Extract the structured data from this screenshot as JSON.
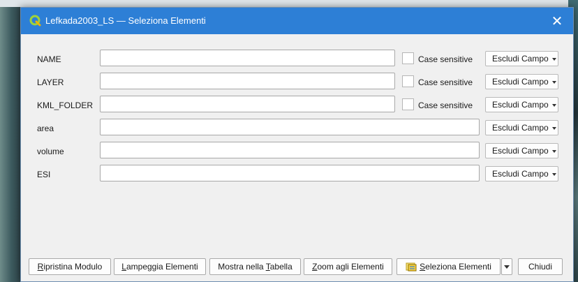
{
  "window": {
    "title": "Lefkada2003_LS — Seleziona Elementi",
    "close_glyph": "✕",
    "app_icon": "qgis-icon",
    "titlebar_color": "#2d7fd6"
  },
  "fields": [
    {
      "label": "NAME",
      "value": "",
      "case_label": "Case sensitive",
      "exclude_label": "Escludi Campo"
    },
    {
      "label": "LAYER",
      "value": "",
      "case_label": "Case sensitive",
      "exclude_label": "Escludi Campo"
    },
    {
      "label": "KML_FOLDER",
      "value": "",
      "case_label": "Case sensitive",
      "exclude_label": "Escludi Campo"
    },
    {
      "label": "area",
      "value": "",
      "exclude_label": "Escludi Campo"
    },
    {
      "label": "volume",
      "value": "",
      "exclude_label": "Escludi Campo"
    },
    {
      "label": "ESI",
      "value": "",
      "exclude_label": "Escludi Campo"
    }
  ],
  "buttons": {
    "reset": {
      "pre": "",
      "mn": "R",
      "post": "ipristina Modulo"
    },
    "flash": {
      "pre": "",
      "mn": "L",
      "post": "ampeggia Elementi"
    },
    "show_table": {
      "pre": "Mostra nella ",
      "mn": "T",
      "post": "abella"
    },
    "zoom": {
      "pre": "",
      "mn": "Z",
      "post": "oom agli Elementi"
    },
    "select": {
      "pre": "",
      "mn": "S",
      "post": "eleziona Elementi",
      "icon": "select-features-icon"
    },
    "close": "Chiudi"
  }
}
